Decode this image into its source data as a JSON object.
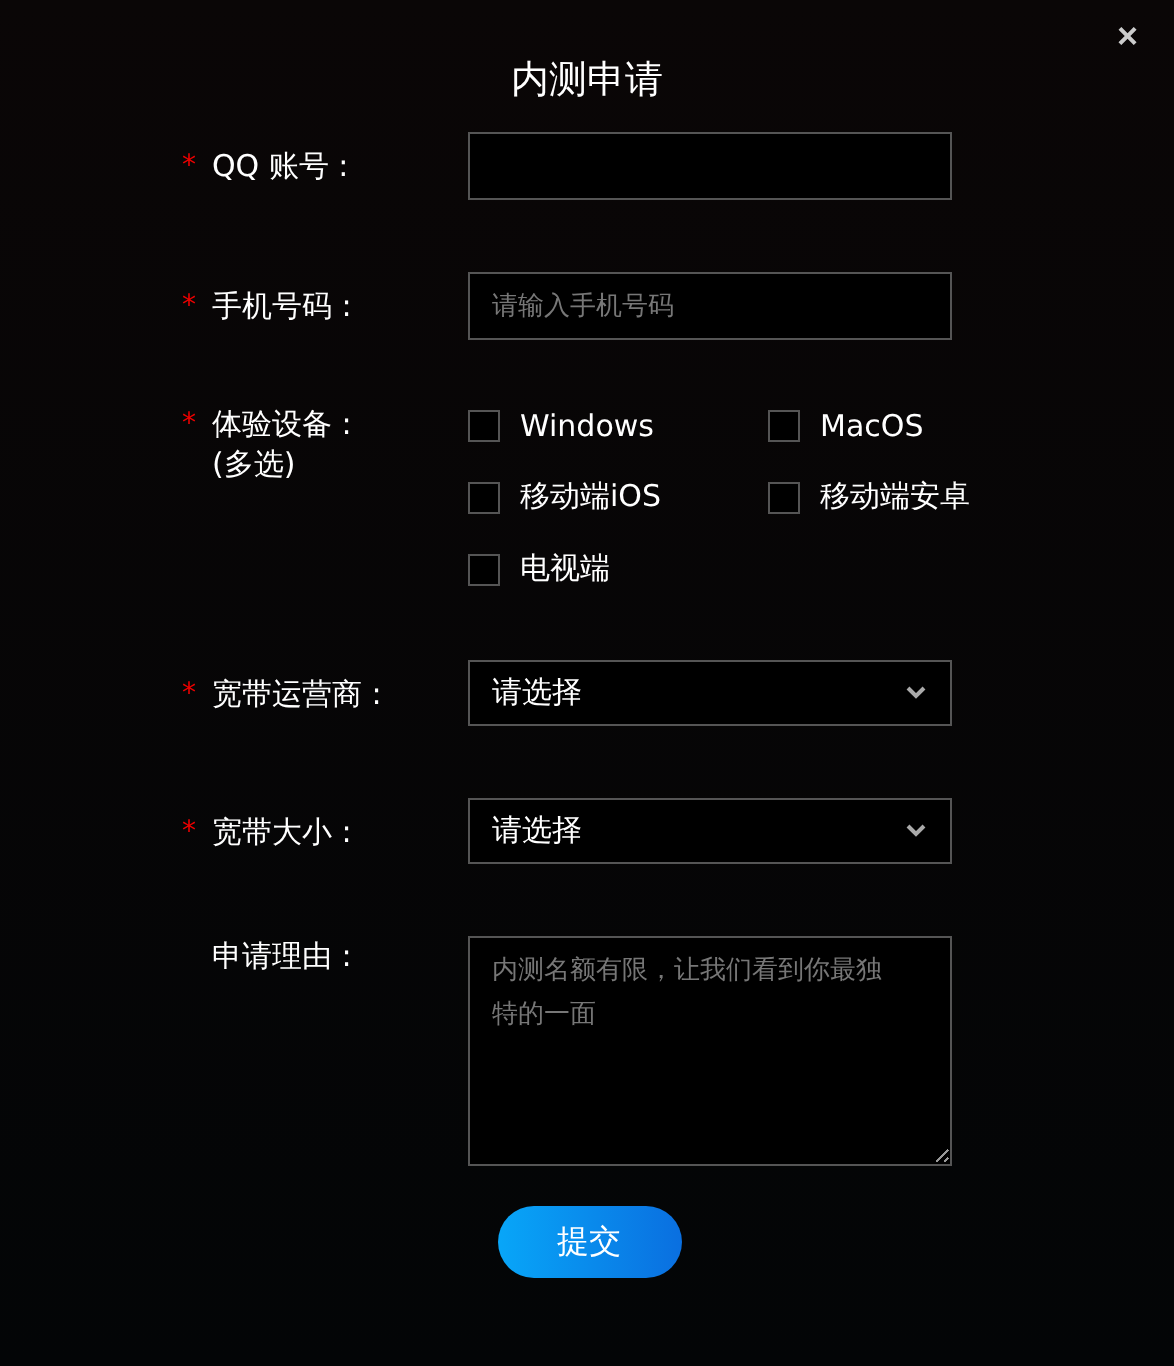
{
  "dialog": {
    "title": "内测申请",
    "close": "×"
  },
  "fields": [
    {
      "kind": "input",
      "label": "QQ 账号 :",
      "required_mark": "*"
    },
    {
      "kind": "input",
      "label": "手机号码 :",
      "required_mark": "*",
      "placeholder": "请输入手机号码"
    },
    {
      "kind": "checkboxes",
      "label": "体验设备 :",
      "sublabel": "(多选)",
      "required_mark": "*",
      "options": [
        {
          "label": "Windows",
          "checked": false
        },
        {
          "label": "MacOS",
          "checked": false
        },
        {
          "label": "移动端iOS",
          "checked": false
        },
        {
          "label": "移动端安卓",
          "checked": false
        },
        {
          "label": "电视端",
          "checked": false
        }
      ]
    },
    {
      "kind": "select",
      "label": "宽带运营商 :",
      "required_mark": "*",
      "value": "请选择"
    },
    {
      "kind": "select",
      "label": "宽带大小 :",
      "required_mark": "*",
      "value": "请选择"
    },
    {
      "kind": "textarea",
      "label": "申请理由 :",
      "placeholder": "内测名额有限，让我们看到你最独特的一面"
    }
  ],
  "submit": "提交"
}
